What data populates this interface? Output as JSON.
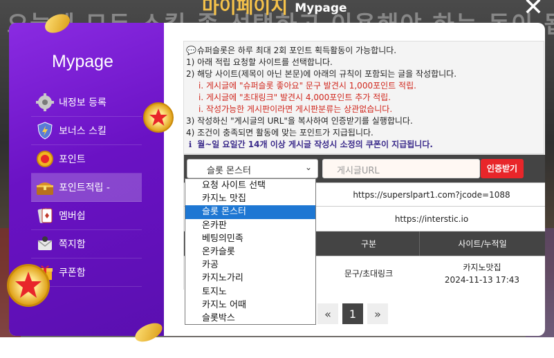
{
  "header": {
    "title_ko": "마이페이지",
    "title_en": "Mypage",
    "close": "✕"
  },
  "sidebar": {
    "title": "Mypage",
    "items": [
      {
        "label": "내정보 등록",
        "icon": "gear-icon",
        "active": false
      },
      {
        "label": "보너스 스킬",
        "icon": "shield-icon",
        "active": false
      },
      {
        "label": "포인트",
        "icon": "coin-icon",
        "active": false
      },
      {
        "label": "포인트적립 -",
        "icon": "treasure-chest-icon",
        "active": true
      },
      {
        "label": "멤버쉽",
        "icon": "cards-icon",
        "active": false
      },
      {
        "label": "쪽지함",
        "icon": "mail-icon",
        "active": false
      },
      {
        "label": "쿠폰함",
        "icon": "gift-icon",
        "active": false
      }
    ]
  },
  "info": {
    "line1": "슈퍼슬롯은 하루 최대 2회 포인트 획득활동이 가능합니다.",
    "line2": "1) 아래 적립 요청할 사이트를 선택합니다.",
    "line3": "2) 해당 사이트(제목이 아닌 본문)에 아래의 규칙이 포함되는 글을 작성합니다.",
    "rule1": "게시글에 \"슈퍼슬롯 좋아요\" 문구 발견시 1,000포인트 적립.",
    "rule2": "게시글에 \"초대링크\" 발견시 4,000포인트 추가 적립.",
    "rule3": "작성가능한 게시판이라면 게시판분류는 상관없습니다.",
    "line4": "3) 작성하신 \"게시글의 URL\"을 복사하여 인증받기를 실행합니다.",
    "line5": "4) 조건이 충족되면 활동에 맞는 포인트가 지급됩니다.",
    "line6": "월~일 요일간 14개 이상 게시글 작성시 소정의 쿠폰이 지급됩니다."
  },
  "form": {
    "selected": "슬롯 몬스터",
    "url_placeholder": "게시글URL",
    "verify_label": "인증받기"
  },
  "links": {
    "invite_url": "https://superslpart1.com?jcode=1088",
    "site_url": "https://interstic.io"
  },
  "table": {
    "headers": [
      "구분",
      "사이트/누적일"
    ],
    "rows": [
      {
        "type": "문구/초대링크",
        "site": "카지노맛집",
        "date": "2024-11-13 17:43"
      }
    ]
  },
  "pagination": {
    "prev": "«",
    "current": "1",
    "next": "»"
  },
  "dropdown": {
    "options": [
      "요청 사이트 선택",
      "카지노 맛집",
      "슬롯 몬스터",
      "온카판",
      "베팅의민족",
      "온카슬롯",
      "카공",
      "카지노가리",
      "토지노",
      "카지노 어때",
      "슬롯박스"
    ],
    "selected_index": 2
  },
  "background": {
    "blur_text": "오늘에 모두 스킬 좀 선택하고 이용해야 하는 돈이 됩니다"
  },
  "colors": {
    "sidebar": "#6a12c4",
    "verify": "#e8262a",
    "title": "#f5c24a"
  }
}
